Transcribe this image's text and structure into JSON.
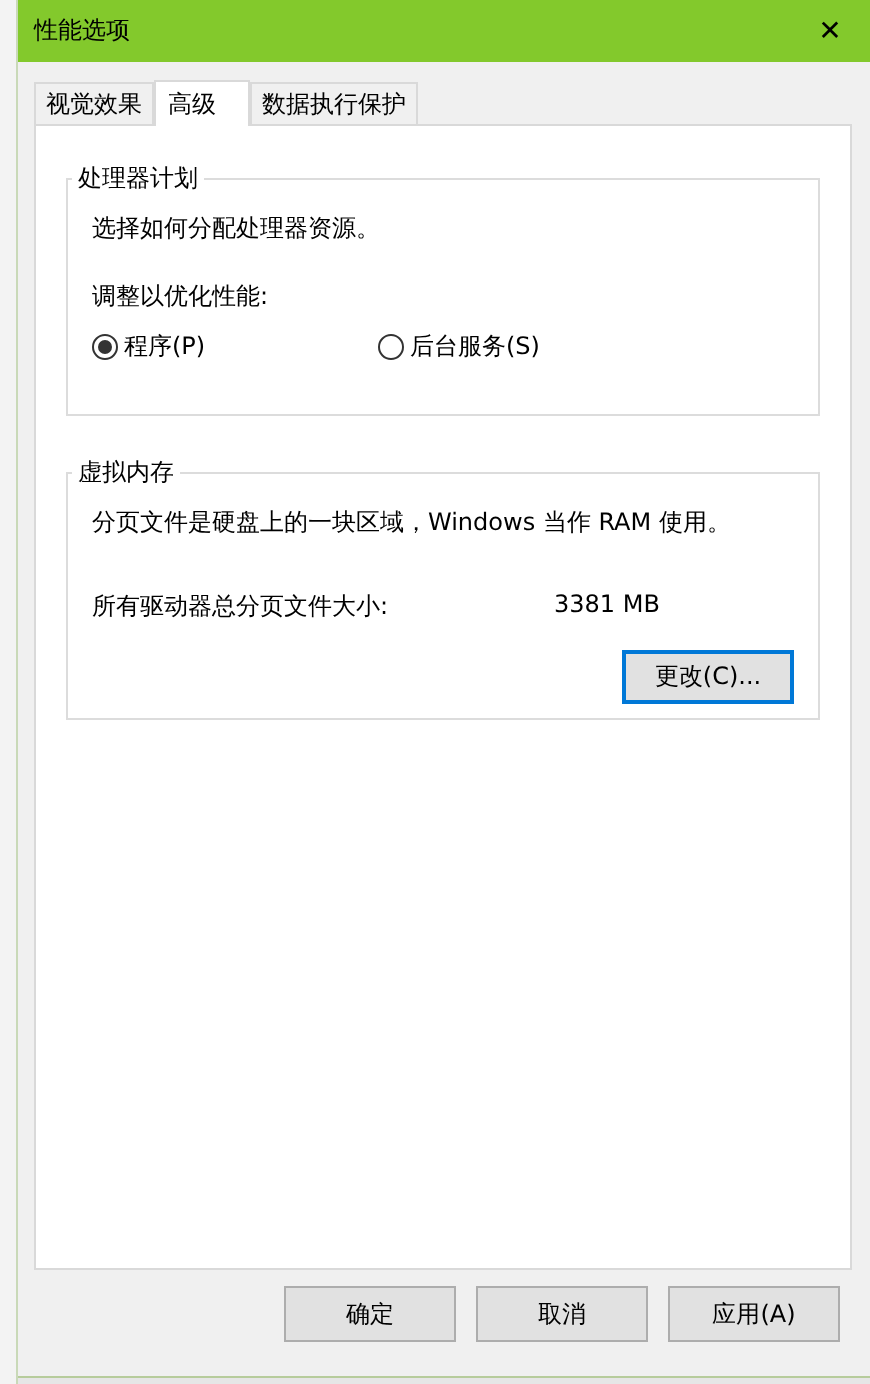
{
  "window": {
    "title": "性能选项",
    "close": "✕"
  },
  "tabs": [
    {
      "label": "视觉效果",
      "selected": false
    },
    {
      "label": "高级",
      "selected": true
    },
    {
      "label": "数据执行保护",
      "selected": false
    }
  ],
  "processor_group": {
    "title": "处理器计划",
    "description": "选择如何分配处理器资源。",
    "adjust_label": "调整以优化性能:",
    "options": [
      {
        "label": "程序(P)",
        "selected": true
      },
      {
        "label": "后台服务(S)",
        "selected": false
      }
    ]
  },
  "virtual_memory_group": {
    "title": "虚拟内存",
    "description": "分页文件是硬盘上的一块区域，Windows 当作 RAM 使用。",
    "total_label": "所有驱动器总分页文件大小:",
    "total_value": "3381 MB",
    "change_button": "更改(C)..."
  },
  "buttons": [
    "确定",
    "取消",
    "应用(A)"
  ]
}
